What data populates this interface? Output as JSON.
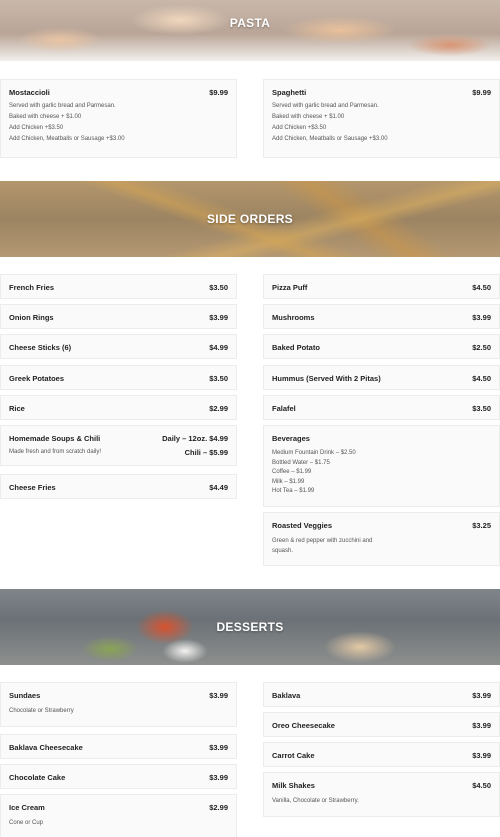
{
  "sections": {
    "pasta": {
      "title": "PASTA",
      "items": [
        {
          "name": "Mostaccioli",
          "price": "$9.99",
          "desc": [
            "Served with garlic bread and Parmesan.",
            "Baked with cheese + $1.00",
            "Add Chicken +$3.50",
            "Add Chicken, Meatballs or Sausage +$3.00"
          ]
        },
        {
          "name": "Spaghetti",
          "price": "$9.99",
          "desc": [
            "Served with garlic bread and Parmesan.",
            "Baked with cheese + $1.00",
            "Add Chicken +$3.50",
            "Add Chicken, Meatballs or Sausage +$3.00"
          ]
        }
      ]
    },
    "sides": {
      "title": "SIDE ORDERS",
      "left": [
        {
          "name": "French Fries",
          "price": "$3.50"
        },
        {
          "name": "Onion Rings",
          "price": "$3.99"
        },
        {
          "name": "Cheese Sticks (6)",
          "price": "$4.99"
        },
        {
          "name": "Greek Potatoes",
          "price": "$3.50"
        },
        {
          "name": "Rice",
          "price": "$2.99"
        },
        {
          "name": "Homemade Soups & Chili",
          "price": "Daily – 12oz. $4.99",
          "desc": "Made fresh and from scratch daily!",
          "price2": "Chili – $5.99"
        },
        {
          "name": "Cheese Fries",
          "price": "$4.49"
        }
      ],
      "right": [
        {
          "name": "Pizza Puff",
          "price": "$4.50"
        },
        {
          "name": "Mushrooms",
          "price": "$3.99"
        },
        {
          "name": "Baked Potato",
          "price": "$2.50"
        },
        {
          "name": "Hummus (Served With 2 Pitas)",
          "price": "$4.50"
        },
        {
          "name": "Falafel",
          "price": "$3.50"
        },
        {
          "name": "Beverages",
          "price": "",
          "desc": [
            "Medium Fountain Drink – $2.50",
            "Bottled Water – $1.75",
            "Coffee – $1.99",
            "Milk – $1.99",
            "Hot Tea – $1.99"
          ]
        },
        {
          "name": "Roasted Veggies",
          "price": "$3.25",
          "desc": [
            "Green & red pepper with zucchini and",
            "squash."
          ]
        }
      ]
    },
    "desserts": {
      "title": "DESSERTS",
      "left": [
        {
          "name": "Sundaes",
          "price": "$3.99",
          "desc": "Chocolate or Strawberry"
        },
        {
          "name": "Baklava Cheesecake",
          "price": "$3.99"
        },
        {
          "name": "Chocolate Cake",
          "price": "$3.99"
        },
        {
          "name": "Ice Cream",
          "price": "$2.99",
          "desc": "Cone or Cup"
        }
      ],
      "right": [
        {
          "name": "Baklava",
          "price": "$3.99"
        },
        {
          "name": "Oreo Cheesecake",
          "price": "$3.99"
        },
        {
          "name": "Carrot Cake",
          "price": "$3.99"
        },
        {
          "name": "Milk Shakes",
          "price": "$4.50",
          "desc": "Vanilla, Chocolate or Strawberry."
        }
      ]
    }
  }
}
